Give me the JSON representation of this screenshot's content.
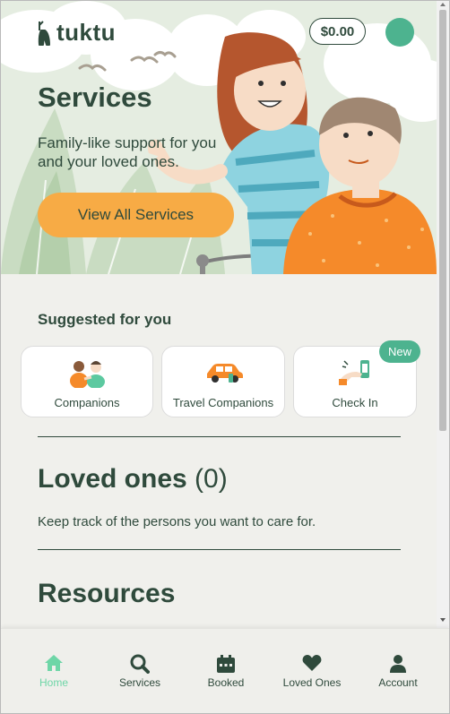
{
  "brand": {
    "name": "tuktu"
  },
  "header": {
    "balance": "$0.00"
  },
  "hero": {
    "title": "Services",
    "subtitle": "Family-like support for you and your loved ones.",
    "cta_label": "View All Services"
  },
  "suggested": {
    "heading": "Suggested for you",
    "items": [
      {
        "label": "Companions",
        "icon": "companions-icon"
      },
      {
        "label": "Travel Companions",
        "icon": "car-icon"
      },
      {
        "label": "Check In",
        "icon": "check-in-icon",
        "badge": "New"
      }
    ]
  },
  "loved_ones": {
    "heading": "Loved ones",
    "count": "(0)",
    "description": "Keep track of the persons you want to care for."
  },
  "resources": {
    "heading": "Resources"
  },
  "bottom_nav": {
    "items": [
      {
        "label": "Home",
        "icon": "home-icon",
        "active": true
      },
      {
        "label": "Services",
        "icon": "search-icon"
      },
      {
        "label": "Booked",
        "icon": "calendar-icon"
      },
      {
        "label": "Loved Ones",
        "icon": "heart-icon"
      },
      {
        "label": "Account",
        "icon": "person-icon"
      }
    ]
  },
  "colors": {
    "primary_dark": "#2f4a3c",
    "accent_green": "#4db38f",
    "active_nav": "#6ed6a7",
    "cta_orange": "#f7ab45",
    "hero_bg": "#e5ede1"
  }
}
